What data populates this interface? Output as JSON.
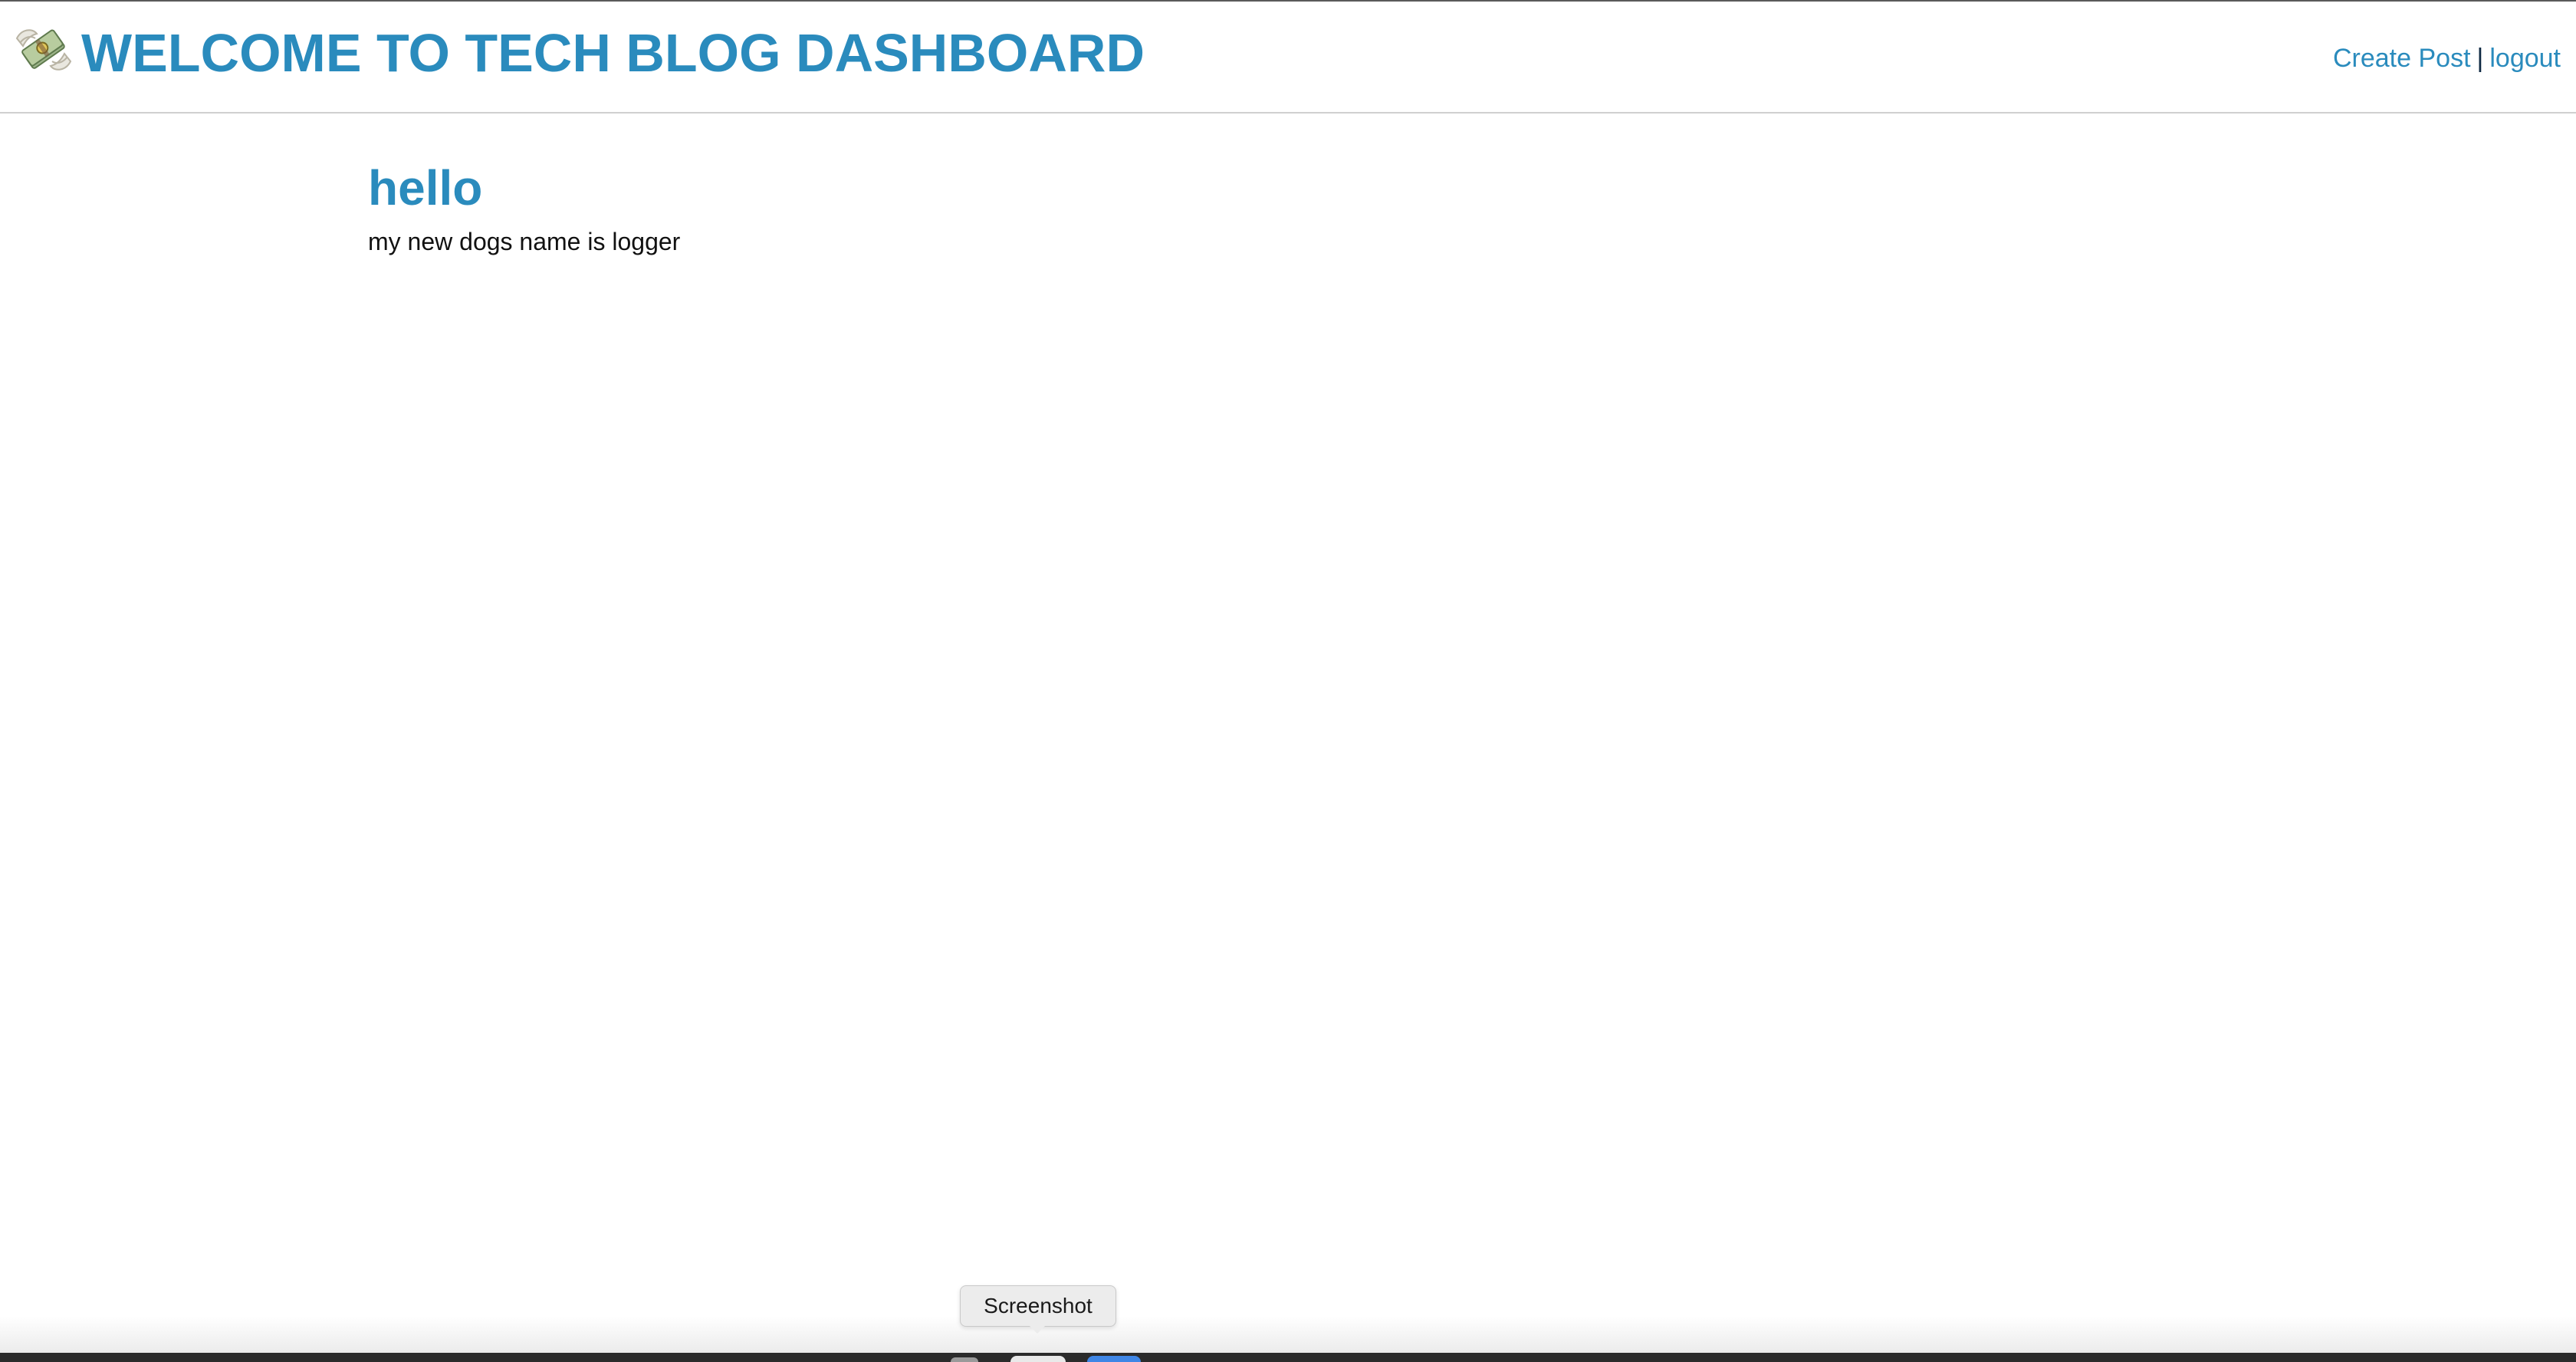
{
  "header": {
    "logo_icon": "money-with-wings-icon",
    "title": "WELCOME TO TECH BLOG DASHBOARD",
    "nav": {
      "create_post": "Create Post",
      "separator": "|",
      "logout": "logout"
    }
  },
  "posts": [
    {
      "title": "hello",
      "body": "my new dogs name is logger"
    }
  ],
  "dock": {
    "tooltip": "Screenshot"
  },
  "colors": {
    "accent": "#2a8bbd",
    "text": "#111111",
    "background": "#ffffff"
  }
}
